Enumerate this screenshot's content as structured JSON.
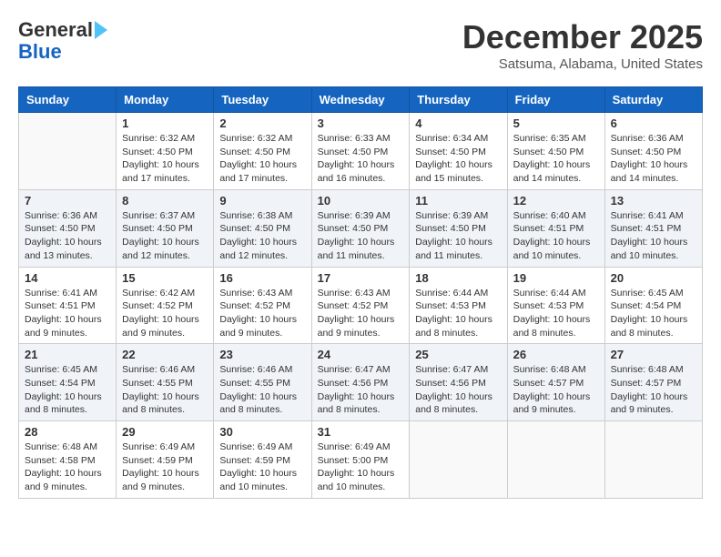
{
  "header": {
    "logo_general": "General",
    "logo_blue": "Blue",
    "month_title": "December 2025",
    "location": "Satsuma, Alabama, United States"
  },
  "weekdays": [
    "Sunday",
    "Monday",
    "Tuesday",
    "Wednesday",
    "Thursday",
    "Friday",
    "Saturday"
  ],
  "weeks": [
    [
      {
        "day": "",
        "content": ""
      },
      {
        "day": "1",
        "content": "Sunrise: 6:32 AM\nSunset: 4:50 PM\nDaylight: 10 hours\nand 17 minutes."
      },
      {
        "day": "2",
        "content": "Sunrise: 6:32 AM\nSunset: 4:50 PM\nDaylight: 10 hours\nand 17 minutes."
      },
      {
        "day": "3",
        "content": "Sunrise: 6:33 AM\nSunset: 4:50 PM\nDaylight: 10 hours\nand 16 minutes."
      },
      {
        "day": "4",
        "content": "Sunrise: 6:34 AM\nSunset: 4:50 PM\nDaylight: 10 hours\nand 15 minutes."
      },
      {
        "day": "5",
        "content": "Sunrise: 6:35 AM\nSunset: 4:50 PM\nDaylight: 10 hours\nand 14 minutes."
      },
      {
        "day": "6",
        "content": "Sunrise: 6:36 AM\nSunset: 4:50 PM\nDaylight: 10 hours\nand 14 minutes."
      }
    ],
    [
      {
        "day": "7",
        "content": "Sunrise: 6:36 AM\nSunset: 4:50 PM\nDaylight: 10 hours\nand 13 minutes."
      },
      {
        "day": "8",
        "content": "Sunrise: 6:37 AM\nSunset: 4:50 PM\nDaylight: 10 hours\nand 12 minutes."
      },
      {
        "day": "9",
        "content": "Sunrise: 6:38 AM\nSunset: 4:50 PM\nDaylight: 10 hours\nand 12 minutes."
      },
      {
        "day": "10",
        "content": "Sunrise: 6:39 AM\nSunset: 4:50 PM\nDaylight: 10 hours\nand 11 minutes."
      },
      {
        "day": "11",
        "content": "Sunrise: 6:39 AM\nSunset: 4:50 PM\nDaylight: 10 hours\nand 11 minutes."
      },
      {
        "day": "12",
        "content": "Sunrise: 6:40 AM\nSunset: 4:51 PM\nDaylight: 10 hours\nand 10 minutes."
      },
      {
        "day": "13",
        "content": "Sunrise: 6:41 AM\nSunset: 4:51 PM\nDaylight: 10 hours\nand 10 minutes."
      }
    ],
    [
      {
        "day": "14",
        "content": "Sunrise: 6:41 AM\nSunset: 4:51 PM\nDaylight: 10 hours\nand 9 minutes."
      },
      {
        "day": "15",
        "content": "Sunrise: 6:42 AM\nSunset: 4:52 PM\nDaylight: 10 hours\nand 9 minutes."
      },
      {
        "day": "16",
        "content": "Sunrise: 6:43 AM\nSunset: 4:52 PM\nDaylight: 10 hours\nand 9 minutes."
      },
      {
        "day": "17",
        "content": "Sunrise: 6:43 AM\nSunset: 4:52 PM\nDaylight: 10 hours\nand 9 minutes."
      },
      {
        "day": "18",
        "content": "Sunrise: 6:44 AM\nSunset: 4:53 PM\nDaylight: 10 hours\nand 8 minutes."
      },
      {
        "day": "19",
        "content": "Sunrise: 6:44 AM\nSunset: 4:53 PM\nDaylight: 10 hours\nand 8 minutes."
      },
      {
        "day": "20",
        "content": "Sunrise: 6:45 AM\nSunset: 4:54 PM\nDaylight: 10 hours\nand 8 minutes."
      }
    ],
    [
      {
        "day": "21",
        "content": "Sunrise: 6:45 AM\nSunset: 4:54 PM\nDaylight: 10 hours\nand 8 minutes."
      },
      {
        "day": "22",
        "content": "Sunrise: 6:46 AM\nSunset: 4:55 PM\nDaylight: 10 hours\nand 8 minutes."
      },
      {
        "day": "23",
        "content": "Sunrise: 6:46 AM\nSunset: 4:55 PM\nDaylight: 10 hours\nand 8 minutes."
      },
      {
        "day": "24",
        "content": "Sunrise: 6:47 AM\nSunset: 4:56 PM\nDaylight: 10 hours\nand 8 minutes."
      },
      {
        "day": "25",
        "content": "Sunrise: 6:47 AM\nSunset: 4:56 PM\nDaylight: 10 hours\nand 8 minutes."
      },
      {
        "day": "26",
        "content": "Sunrise: 6:48 AM\nSunset: 4:57 PM\nDaylight: 10 hours\nand 9 minutes."
      },
      {
        "day": "27",
        "content": "Sunrise: 6:48 AM\nSunset: 4:57 PM\nDaylight: 10 hours\nand 9 minutes."
      }
    ],
    [
      {
        "day": "28",
        "content": "Sunrise: 6:48 AM\nSunset: 4:58 PM\nDaylight: 10 hours\nand 9 minutes."
      },
      {
        "day": "29",
        "content": "Sunrise: 6:49 AM\nSunset: 4:59 PM\nDaylight: 10 hours\nand 9 minutes."
      },
      {
        "day": "30",
        "content": "Sunrise: 6:49 AM\nSunset: 4:59 PM\nDaylight: 10 hours\nand 10 minutes."
      },
      {
        "day": "31",
        "content": "Sunrise: 6:49 AM\nSunset: 5:00 PM\nDaylight: 10 hours\nand 10 minutes."
      },
      {
        "day": "",
        "content": ""
      },
      {
        "day": "",
        "content": ""
      },
      {
        "day": "",
        "content": ""
      }
    ]
  ]
}
